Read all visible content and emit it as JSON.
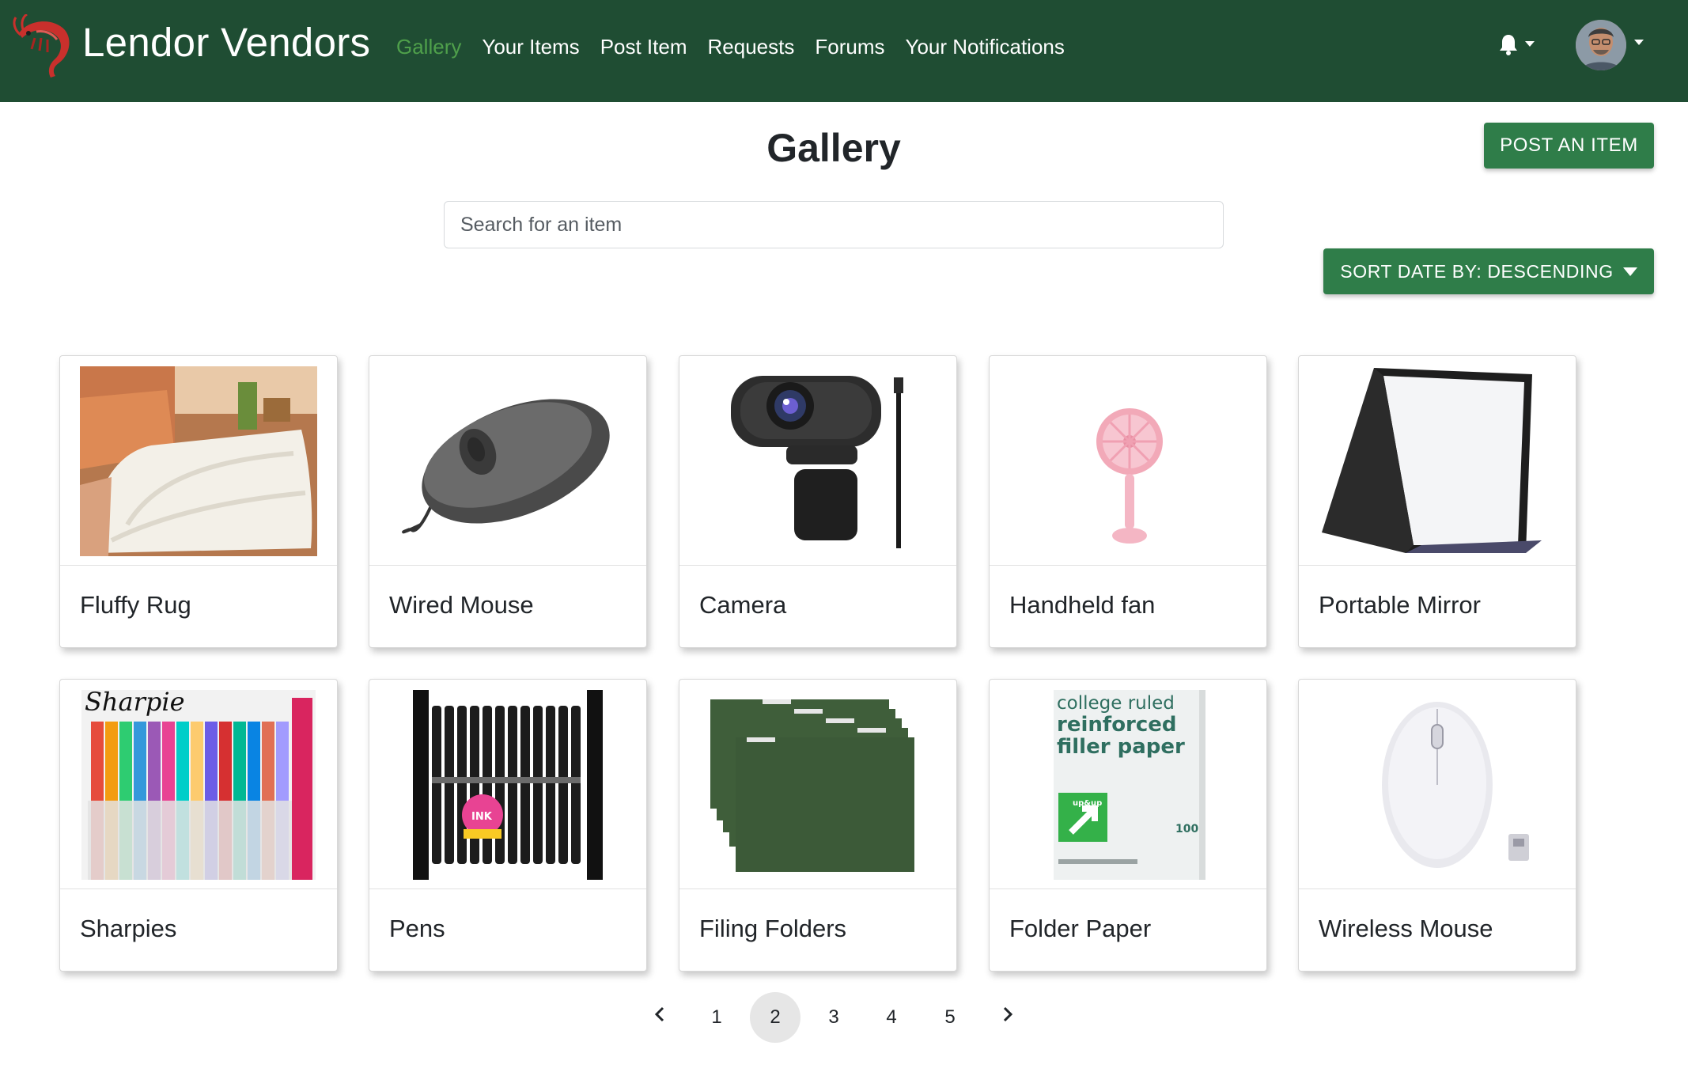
{
  "nav": {
    "brand": "Lendor Vendors",
    "links": [
      "Gallery",
      "Your Items",
      "Post Item",
      "Requests",
      "Forums",
      "Your Notifications"
    ],
    "active_link": "Gallery"
  },
  "header": {
    "title": "Gallery",
    "post_button": "POST AN ITEM",
    "search_placeholder": "Search for an item",
    "sort_button": "SORT DATE BY: DESCENDING"
  },
  "items": [
    {
      "title": "Fluffy Rug",
      "icon": "rug-image"
    },
    {
      "title": "Wired Mouse",
      "icon": "wired-mouse-image"
    },
    {
      "title": "Camera",
      "icon": "webcam-image"
    },
    {
      "title": "Handheld fan",
      "icon": "handheld-fan-image"
    },
    {
      "title": "Portable Mirror",
      "icon": "portable-mirror-image"
    },
    {
      "title": "Sharpies",
      "icon": "sharpies-image",
      "img_text": "Sharpie"
    },
    {
      "title": "Pens",
      "icon": "pens-image",
      "img_text": "INK"
    },
    {
      "title": "Filing Folders",
      "icon": "filing-folders-image"
    },
    {
      "title": "Folder Paper",
      "icon": "filler-paper-image",
      "img_text": [
        "college ruled",
        "reinforced",
        "filler paper",
        "up&up",
        "100"
      ]
    },
    {
      "title": "Wireless Mouse",
      "icon": "wireless-mouse-image"
    }
  ],
  "pagination": {
    "pages": [
      "1",
      "2",
      "3",
      "4",
      "5"
    ],
    "current": "2"
  },
  "colors": {
    "navbar": "#1f4d33",
    "active_link": "#4fa04b",
    "button": "#2f7d49"
  }
}
